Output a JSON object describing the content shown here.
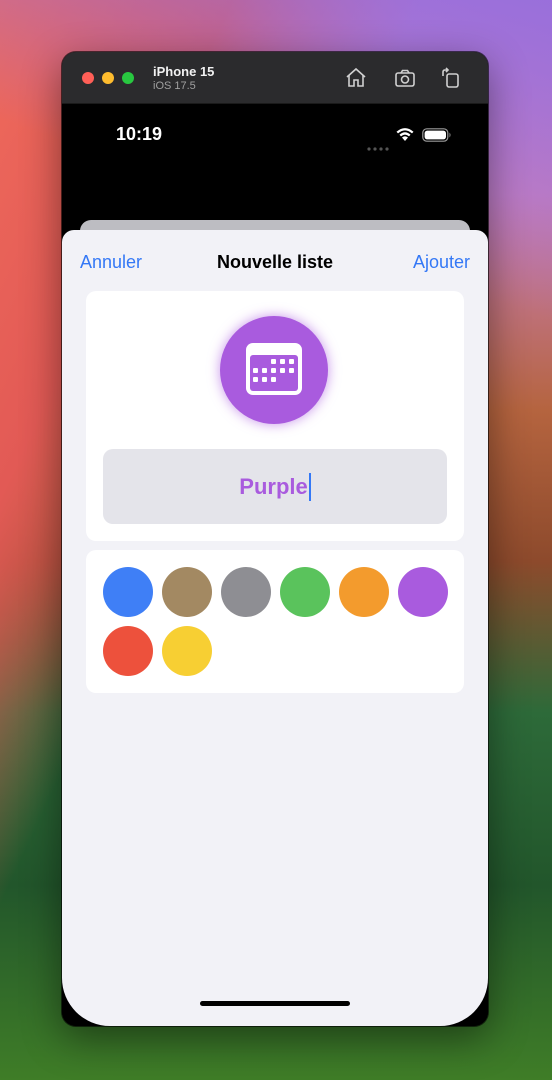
{
  "simulator": {
    "device_name": "iPhone 15",
    "os_version": "iOS 17.5",
    "toolbar_icons": [
      "home-icon",
      "screenshot-icon",
      "rotate-icon"
    ]
  },
  "status_bar": {
    "time": "10:19",
    "icons": [
      "signal-dots-icon",
      "wifi-icon",
      "battery-icon"
    ]
  },
  "nav": {
    "cancel_label": "Annuler",
    "title": "Nouvelle liste",
    "add_label": "Ajouter"
  },
  "list_icon": {
    "icon": "calendar-icon",
    "color": "#a95bde"
  },
  "name_field": {
    "value": "Purple"
  },
  "colors": [
    {
      "name": "blue",
      "hex": "#3f7ff6"
    },
    {
      "name": "brown",
      "hex": "#a38962"
    },
    {
      "name": "gray",
      "hex": "#8e8e93"
    },
    {
      "name": "green",
      "hex": "#5ac35c"
    },
    {
      "name": "orange",
      "hex": "#f39b2d"
    },
    {
      "name": "purple",
      "hex": "#a95bde"
    },
    {
      "name": "red",
      "hex": "#ed513c"
    },
    {
      "name": "yellow",
      "hex": "#f7cf33"
    }
  ],
  "accent_color": "#3478f6"
}
